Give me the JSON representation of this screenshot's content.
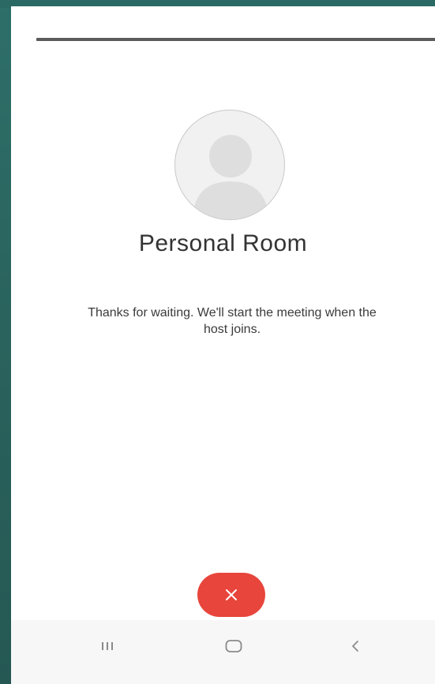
{
  "room": {
    "title": "Personal Room",
    "message": "Thanks for waiting. We'll start the meeting when the host joins."
  },
  "icons": {
    "avatar": "person-placeholder-icon",
    "end_call": "close-icon",
    "recents": "recents-icon",
    "home": "home-icon",
    "back": "back-icon"
  },
  "colors": {
    "background_frame": "#2a6661",
    "end_button": "#e8453c",
    "screen": "#ffffff"
  }
}
